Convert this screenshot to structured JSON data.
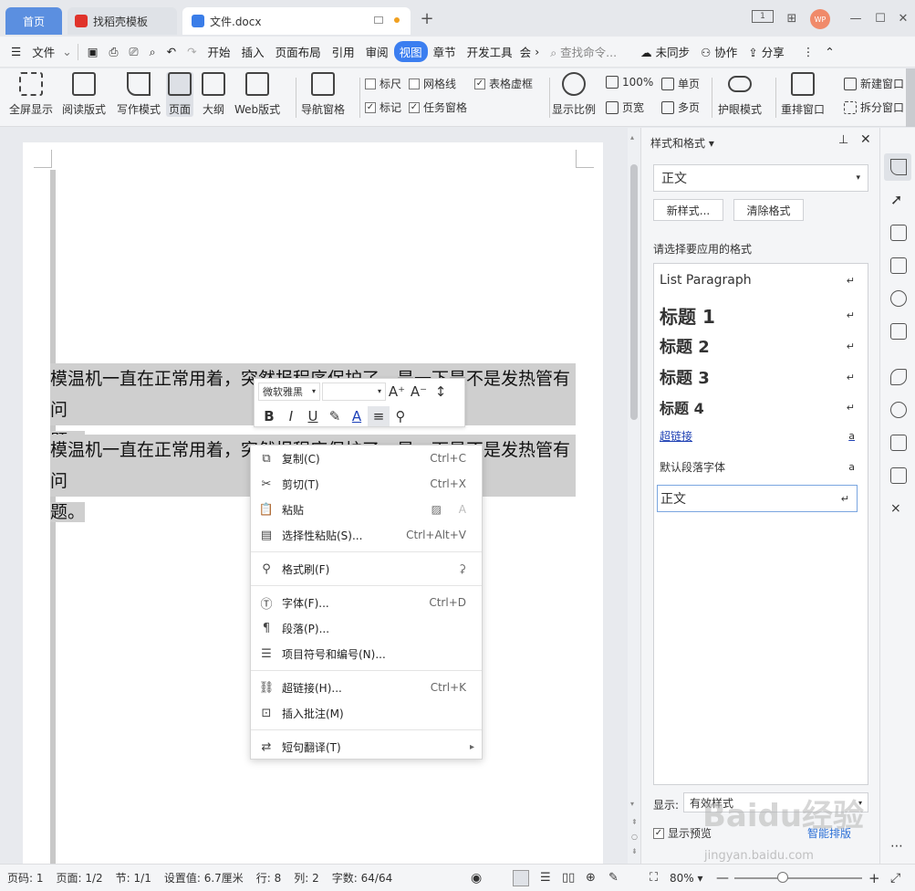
{
  "titlebar": {
    "tabs": [
      {
        "label": "首页"
      },
      {
        "label": "找稻壳模板"
      },
      {
        "label": "文件.docx"
      }
    ],
    "avatar": "WP"
  },
  "menu": {
    "file": "文件",
    "items": [
      "开始",
      "插入",
      "页面布局",
      "引用",
      "审阅",
      "视图",
      "章节",
      "开发工具",
      "会"
    ],
    "active": "视图",
    "search_placeholder": "查找命令...",
    "right": [
      "未同步",
      "协作",
      "分享"
    ]
  },
  "ribbon": {
    "big_buttons": [
      "全屏显示",
      "阅读版式",
      "写作模式",
      "页面",
      "大纲",
      "Web版式",
      "导航窗格"
    ],
    "checkboxes": [
      {
        "label": "标尺",
        "checked": false
      },
      {
        "label": "网格线",
        "checked": false
      },
      {
        "label": "表格虚框",
        "checked": true
      },
      {
        "label": "标记",
        "checked": true
      },
      {
        "label": "任务窗格",
        "checked": true
      }
    ],
    "zoom_group": {
      "show_ratio": "显示比例",
      "p100": "100%",
      "page_width": "页宽",
      "single": "单页",
      "multi": "多页"
    },
    "eye": "护眼模式",
    "rearrange": "重排窗口",
    "new_window": "新建窗口",
    "split_window": "拆分窗口"
  },
  "document": {
    "paragraphs": [
      "模温机一直在正常用着，突然报程序保护了，是一下是不是发热管有问题。",
      "模温机一直在正常用着，突然报程序保护了，是一下是不是发热管有问题。"
    ],
    "para_line1": "模温机一直在正常用着，突然报程序保护了，是一下是不是发热管有问",
    "para_line2": "题。"
  },
  "mini_toolbar": {
    "font": "微软雅黑",
    "size": ""
  },
  "context_menu": {
    "items": [
      {
        "label": "复制(C)",
        "shortcut": "Ctrl+C"
      },
      {
        "label": "剪切(T)",
        "shortcut": "Ctrl+X"
      },
      {
        "label": "粘贴",
        "shortcut": ""
      },
      {
        "label": "选择性粘贴(S)...",
        "shortcut": "Ctrl+Alt+V"
      },
      {
        "label": "格式刷(F)",
        "shortcut": ""
      },
      {
        "label": "字体(F)...",
        "shortcut": "Ctrl+D"
      },
      {
        "label": "段落(P)...",
        "shortcut": ""
      },
      {
        "label": "项目符号和编号(N)...",
        "shortcut": ""
      },
      {
        "label": "超链接(H)...",
        "shortcut": "Ctrl+K"
      },
      {
        "label": "插入批注(M)",
        "shortcut": ""
      },
      {
        "label": "短句翻译(T)",
        "shortcut": ""
      }
    ]
  },
  "style_panel": {
    "title": "样式和格式",
    "current_style": "正文",
    "new_style": "新样式...",
    "clear_format": "清除格式",
    "prompt": "请选择要应用的格式",
    "styles": [
      {
        "label": "List Paragraph",
        "mark": "↵"
      },
      {
        "label": "标题 1",
        "mark": "↵"
      },
      {
        "label": "标题 2",
        "mark": "↵"
      },
      {
        "label": "标题 3",
        "mark": "↵"
      },
      {
        "label": "标题 4",
        "mark": "↵"
      },
      {
        "label": "超链接",
        "mark": "a"
      },
      {
        "label": "默认段落字体",
        "mark": "a"
      },
      {
        "label": "正文",
        "mark": "↵"
      }
    ],
    "show_label": "显示:",
    "show_value": "有效样式",
    "preview_label": "显示预览",
    "preview_checked": true,
    "smart_btn": "智能排版"
  },
  "status": {
    "page": "页码: 1",
    "pages": "页面: 1/2",
    "section": "节: 1/1",
    "setting": "设置值: 6.7厘米",
    "row": "行: 8",
    "col": "列: 2",
    "words": "字数: 64/64",
    "zoom": "80%"
  },
  "watermark": {
    "brand": "Baidu经验",
    "url": "jingyan.baidu.com"
  }
}
